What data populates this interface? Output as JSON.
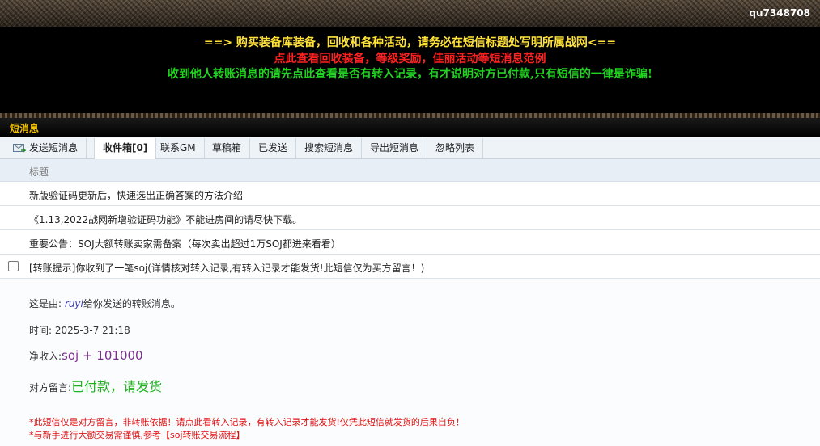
{
  "header": {
    "username": "qu7348708"
  },
  "notices": [
    {
      "text": "==> 购买装备库装备，回收和各种活动，请务必在短信标题处写明所属战网<==",
      "color": "#ffe23a"
    },
    {
      "text": "点此查看回收装备，等级奖励，佳丽活动等短消息范例",
      "color": "#ff2222"
    },
    {
      "text": "收到他人转账消息的请先点此查看是否有转入记录，有才说明对方已付款,只有短信的一律是诈骗!",
      "color": "#22d222"
    }
  ],
  "section": {
    "title": "短消息"
  },
  "tabs": [
    {
      "label": "发送短消息",
      "icon": "mail-send-icon"
    },
    {
      "label": "收件箱[0]",
      "active": true
    },
    {
      "label": "联系GM"
    },
    {
      "label": "草稿箱"
    },
    {
      "label": "已发送"
    },
    {
      "label": "搜索短消息"
    },
    {
      "label": "导出短消息"
    },
    {
      "label": "忽略列表"
    }
  ],
  "list": {
    "header": "标题",
    "rows": [
      {
        "title": "新版验证码更新后，快速选出正确答案的方法介绍"
      },
      {
        "title": "《1.13,2022战网新增验证码功能》不能进房间的请尽快下载。"
      },
      {
        "title": "重要公告：SOJ大额转账卖家需备案（每次卖出超过1万SOJ都进来看看）"
      },
      {
        "title": "[转账提示]你收到了一笔soj(详情核对转入记录,有转入记录才能发货!此短信仅为买方留言！)",
        "checkbox": true
      }
    ]
  },
  "detail": {
    "from_prefix": "这是由:",
    "from_name": "ruyi",
    "from_suffix": "给你发送的转账消息。",
    "time_label": "时间:",
    "time_value": "2025-3-7 21:18",
    "net_label": "净收入:",
    "net_value": "soj + 101000",
    "msg_label": "对方留言:",
    "msg_value": "已付款，请发货",
    "warning1": "*此短信仅是对方留言，非转账依据！请点此看转入记录，有转入记录才能发货!仅凭此短信就发货的后果自负！",
    "warning2": "*与新手进行大额交易需谨慎,参考【soj转账交易流程】"
  }
}
